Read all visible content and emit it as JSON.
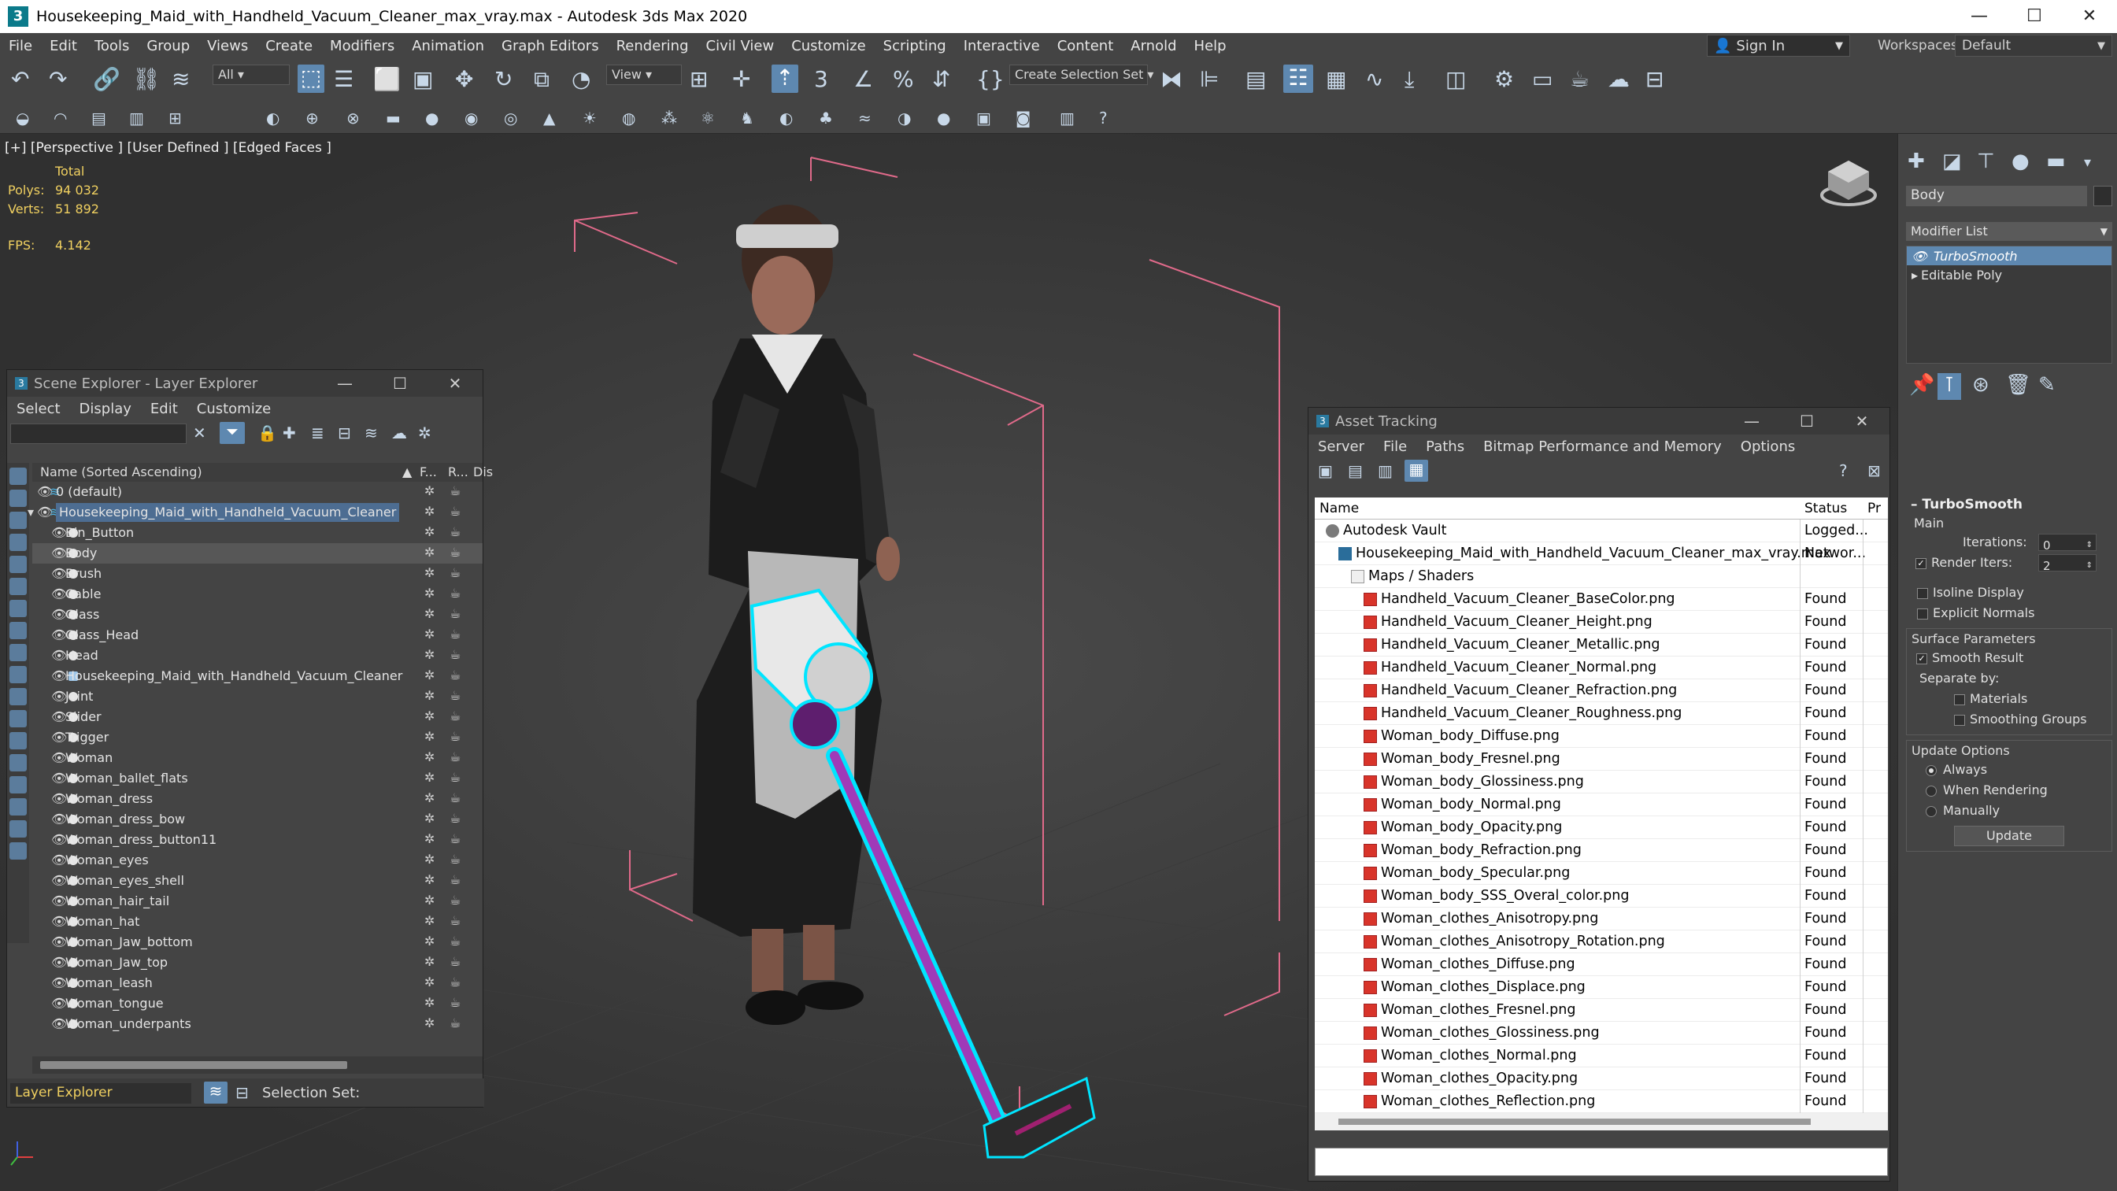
{
  "window": {
    "title": "Housekeeping_Maid_with_Handheld_Vacuum_Cleaner_max_vray.max - Autodesk 3ds Max 2020",
    "app_icon": "3",
    "minimize": "—",
    "maximize": "☐",
    "close": "✕"
  },
  "menu": [
    "File",
    "Edit",
    "Tools",
    "Group",
    "Views",
    "Create",
    "Modifiers",
    "Animation",
    "Graph Editors",
    "Rendering",
    "Civil View",
    "Customize",
    "Scripting",
    "Interactive",
    "Content",
    "Arnold",
    "Help"
  ],
  "account": {
    "sign_in": "Sign In"
  },
  "workspace": {
    "label": "Workspaces:",
    "value": "Default"
  },
  "toolbar": {
    "filter_combo": "All",
    "view_combo": "View",
    "selection_set_combo": "Create Selection Set"
  },
  "viewport": {
    "label": "[+] [Perspective ] [User Defined ] [Edged Faces ]",
    "stats_header": "Total",
    "polys_label": "Polys:",
    "polys_value": "94 032",
    "verts_label": "Verts:",
    "verts_value": "51 892",
    "fps_label": "FPS:",
    "fps_value": "4.142"
  },
  "scene_explorer": {
    "title": "Scene Explorer - Layer Explorer",
    "menu": [
      "Select",
      "Display",
      "Edit",
      "Customize"
    ],
    "columns": {
      "name": "Name (Sorted Ascending)",
      "frozen": "F...",
      "render": "R...",
      "display": "Dis"
    },
    "rows": [
      {
        "name": "0 (default)",
        "level": 0,
        "kind": "layer"
      },
      {
        "name": "Housekeeping_Maid_with_Handheld_Vacuum_Cleaner",
        "level": 0,
        "kind": "layer-active"
      },
      {
        "name": "Bin_Button",
        "level": 1,
        "kind": "object"
      },
      {
        "name": "Body",
        "level": 1,
        "kind": "object",
        "selected": true
      },
      {
        "name": "Brush",
        "level": 1,
        "kind": "object"
      },
      {
        "name": "Cable",
        "level": 1,
        "kind": "object"
      },
      {
        "name": "Glass",
        "level": 1,
        "kind": "object"
      },
      {
        "name": "Glass_Head",
        "level": 1,
        "kind": "object"
      },
      {
        "name": "Head",
        "level": 1,
        "kind": "object"
      },
      {
        "name": "Housekeeping_Maid_with_Handheld_Vacuum_Cleaner",
        "level": 1,
        "kind": "group"
      },
      {
        "name": "Joint",
        "level": 1,
        "kind": "object"
      },
      {
        "name": "Slider",
        "level": 1,
        "kind": "object"
      },
      {
        "name": "Trigger",
        "level": 1,
        "kind": "object"
      },
      {
        "name": "Woman",
        "level": 1,
        "kind": "object"
      },
      {
        "name": "Woman_ballet_flats",
        "level": 1,
        "kind": "object"
      },
      {
        "name": "Woman_dress",
        "level": 1,
        "kind": "object"
      },
      {
        "name": "Woman_dress_bow",
        "level": 1,
        "kind": "object"
      },
      {
        "name": "Woman_dress_button11",
        "level": 1,
        "kind": "object"
      },
      {
        "name": "Woman_eyes",
        "level": 1,
        "kind": "object"
      },
      {
        "name": "Woman_eyes_shell",
        "level": 1,
        "kind": "object"
      },
      {
        "name": "Woman_hair_tail",
        "level": 1,
        "kind": "object"
      },
      {
        "name": "Woman_hat",
        "level": 1,
        "kind": "object"
      },
      {
        "name": "Woman_Jaw_bottom",
        "level": 1,
        "kind": "object"
      },
      {
        "name": "Woman_Jaw_top",
        "level": 1,
        "kind": "object"
      },
      {
        "name": "Woman_leash",
        "level": 1,
        "kind": "object"
      },
      {
        "name": "Woman_tongue",
        "level": 1,
        "kind": "object"
      },
      {
        "name": "Woman_underpants",
        "level": 1,
        "kind": "object"
      }
    ],
    "footer": {
      "explorer_combo": "Layer Explorer",
      "selection_set_label": "Selection Set:"
    }
  },
  "asset_tracking": {
    "title": "Asset Tracking",
    "menu": [
      "Server",
      "File",
      "Paths",
      "Bitmap Performance and Memory",
      "Options"
    ],
    "columns": {
      "name": "Name",
      "status": "Status",
      "pr": "Pr"
    },
    "rows": [
      {
        "name": "Autodesk Vault",
        "status": "Logged...",
        "level": 0,
        "icon": "vault"
      },
      {
        "name": "Housekeeping_Maid_with_Handheld_Vacuum_Cleaner_max_vray.max",
        "status": "Networ...",
        "level": 1,
        "icon": "max"
      },
      {
        "name": "Maps / Shaders",
        "status": "",
        "level": 2,
        "icon": "folder"
      },
      {
        "name": "Handheld_Vacuum_Cleaner_BaseColor.png",
        "status": "Found",
        "level": 3,
        "icon": "png"
      },
      {
        "name": "Handheld_Vacuum_Cleaner_Height.png",
        "status": "Found",
        "level": 3,
        "icon": "png"
      },
      {
        "name": "Handheld_Vacuum_Cleaner_Metallic.png",
        "status": "Found",
        "level": 3,
        "icon": "png"
      },
      {
        "name": "Handheld_Vacuum_Cleaner_Normal.png",
        "status": "Found",
        "level": 3,
        "icon": "png"
      },
      {
        "name": "Handheld_Vacuum_Cleaner_Refraction.png",
        "status": "Found",
        "level": 3,
        "icon": "png"
      },
      {
        "name": "Handheld_Vacuum_Cleaner_Roughness.png",
        "status": "Found",
        "level": 3,
        "icon": "png"
      },
      {
        "name": "Woman_body_Diffuse.png",
        "status": "Found",
        "level": 3,
        "icon": "png"
      },
      {
        "name": "Woman_body_Fresnel.png",
        "status": "Found",
        "level": 3,
        "icon": "png"
      },
      {
        "name": "Woman_body_Glossiness.png",
        "status": "Found",
        "level": 3,
        "icon": "png"
      },
      {
        "name": "Woman_body_Normal.png",
        "status": "Found",
        "level": 3,
        "icon": "png"
      },
      {
        "name": "Woman_body_Opacity.png",
        "status": "Found",
        "level": 3,
        "icon": "png"
      },
      {
        "name": "Woman_body_Refraction.png",
        "status": "Found",
        "level": 3,
        "icon": "png"
      },
      {
        "name": "Woman_body_Specular.png",
        "status": "Found",
        "level": 3,
        "icon": "png"
      },
      {
        "name": "Woman_body_SSS_Overal_color.png",
        "status": "Found",
        "level": 3,
        "icon": "png"
      },
      {
        "name": "Woman_clothes_Anisotropy.png",
        "status": "Found",
        "level": 3,
        "icon": "png"
      },
      {
        "name": "Woman_clothes_Anisotropy_Rotation.png",
        "status": "Found",
        "level": 3,
        "icon": "png"
      },
      {
        "name": "Woman_clothes_Diffuse.png",
        "status": "Found",
        "level": 3,
        "icon": "png"
      },
      {
        "name": "Woman_clothes_Displace.png",
        "status": "Found",
        "level": 3,
        "icon": "png"
      },
      {
        "name": "Woman_clothes_Fresnel.png",
        "status": "Found",
        "level": 3,
        "icon": "png"
      },
      {
        "name": "Woman_clothes_Glossiness.png",
        "status": "Found",
        "level": 3,
        "icon": "png"
      },
      {
        "name": "Woman_clothes_Normal.png",
        "status": "Found",
        "level": 3,
        "icon": "png"
      },
      {
        "name": "Woman_clothes_Opacity.png",
        "status": "Found",
        "level": 3,
        "icon": "png"
      },
      {
        "name": "Woman_clothes_Reflection.png",
        "status": "Found",
        "level": 3,
        "icon": "png"
      }
    ]
  },
  "command_panel": {
    "object_name": "Body",
    "modifier_list": "Modifier List",
    "stack": [
      {
        "name": "TurboSmooth",
        "selected": true
      },
      {
        "name": "Editable Poly",
        "selected": false
      }
    ],
    "rollout": {
      "title": "TurboSmooth",
      "main": "Main",
      "iterations_label": "Iterations:",
      "iterations_value": "0",
      "render_iters_label": "Render Iters:",
      "render_iters_value": "2",
      "isoline_display": "Isoline Display",
      "explicit_normals": "Explicit Normals",
      "surface_params": "Surface Parameters",
      "smooth_result": "Smooth Result",
      "separate_by": "Separate by:",
      "materials": "Materials",
      "smoothing_groups": "Smoothing Groups",
      "update_options": "Update Options",
      "always": "Always",
      "when_rendering": "When Rendering",
      "manually": "Manually",
      "update_button": "Update"
    }
  },
  "colors": {
    "selection_cyan": "#00e5ff",
    "bbox_pink": "#e06a8a",
    "stats_yellow": "#f0d060",
    "accent_blue": "#5e88b0"
  }
}
